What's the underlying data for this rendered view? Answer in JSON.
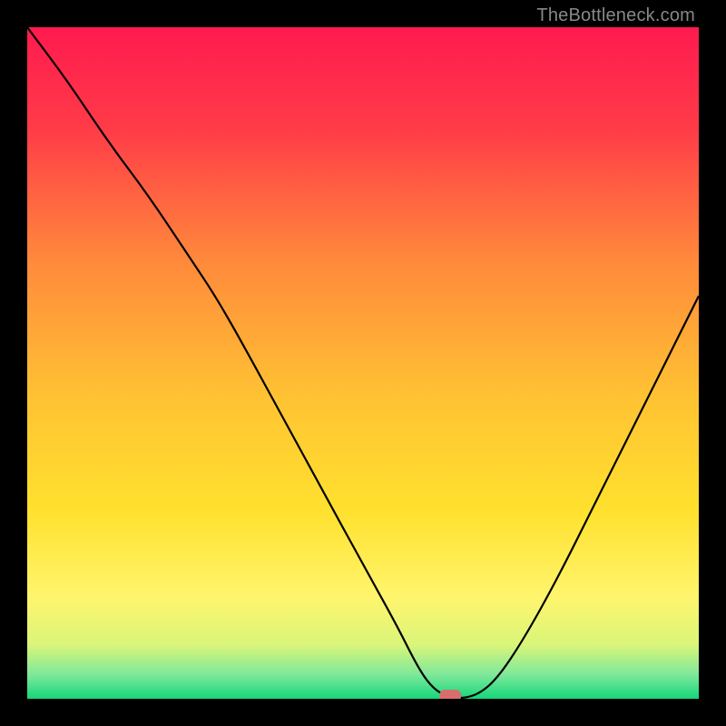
{
  "site": {
    "watermark": "TheBottleneck.com"
  },
  "chart_data": {
    "type": "line",
    "title": "",
    "xlabel": "",
    "ylabel": "",
    "xlim": [
      0,
      100
    ],
    "ylim": [
      0,
      100
    ],
    "grid": false,
    "legend": false,
    "background_gradient": {
      "stops": [
        {
          "pos": 0.0,
          "color": "#ff1a4f"
        },
        {
          "pos": 0.15,
          "color": "#ff3b48"
        },
        {
          "pos": 0.35,
          "color": "#ff8a3b"
        },
        {
          "pos": 0.55,
          "color": "#ffc233"
        },
        {
          "pos": 0.72,
          "color": "#ffe12e"
        },
        {
          "pos": 0.85,
          "color": "#fff56d"
        },
        {
          "pos": 0.92,
          "color": "#d9f57a"
        },
        {
          "pos": 0.965,
          "color": "#7ce89a"
        },
        {
          "pos": 1.0,
          "color": "#15d67a"
        }
      ]
    },
    "series": [
      {
        "name": "bottleneck-curve",
        "x": [
          0,
          6,
          12,
          18,
          24,
          28,
          32,
          38,
          44,
          50,
          55,
          58,
          60,
          62,
          64,
          67,
          70,
          74,
          79,
          85,
          92,
          100
        ],
        "y": [
          100,
          92,
          83,
          75,
          66,
          60,
          53,
          42,
          31,
          20,
          11,
          5,
          2,
          0.5,
          0,
          0.5,
          3,
          9,
          18,
          30,
          44,
          60
        ]
      }
    ],
    "marker": {
      "x": 63,
      "y": 0
    }
  }
}
